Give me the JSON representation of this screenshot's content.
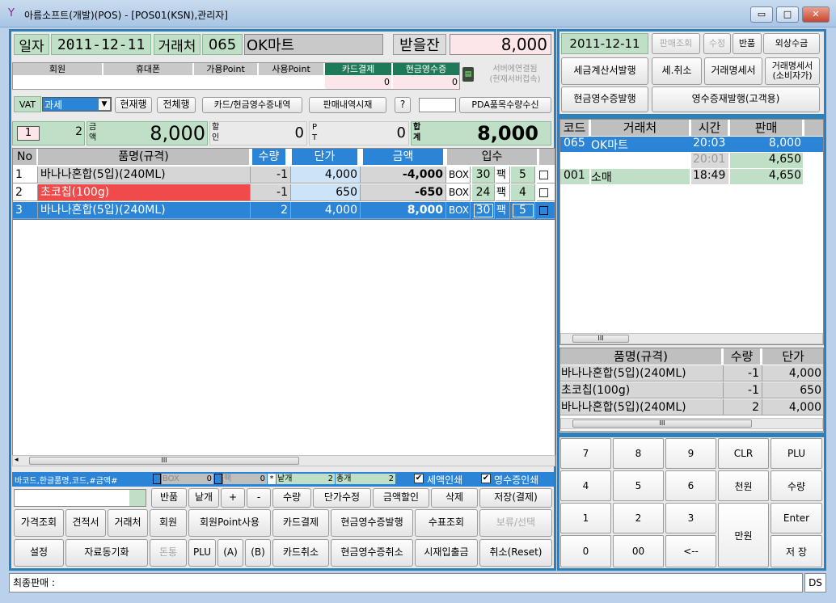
{
  "window": {
    "title": "아름소프트(개발)(POS) - [POS01(KSN),관리자]",
    "min": "▭",
    "max": "□",
    "close": "✕"
  },
  "header": {
    "date_label": "일자",
    "date": "2011-12-11",
    "client_label": "거래처",
    "client_code": "065",
    "client_name": "OK마트",
    "receive_label": "받을잔",
    "receive_amount": "8,000"
  },
  "member": {
    "cols": [
      "회원",
      "휴대폰",
      "가용Point",
      "사용Point",
      "카드결제",
      "현금영수증"
    ],
    "card_value": "0",
    "cash_receipt_value": "0",
    "server_status": "서버에연결됨\n(현재서버접속)"
  },
  "toolbar": {
    "vat_label": "VAT",
    "vat_value": "과세",
    "buttons": [
      "현재행",
      "전체행",
      "카드/현금영수증내역",
      "판매내역시재",
      "?"
    ],
    "pda_label": "PDA품목수량수신"
  },
  "totals": {
    "count_box": "1",
    "count": "2",
    "amount_label": "금\n액",
    "amount": "8,000",
    "discount_label": "할\n인",
    "discount": "0",
    "pt_label": "P\nT",
    "pt": "0",
    "total_label": "합\n계",
    "total": "8,000"
  },
  "table": {
    "headers": [
      "No",
      "품명(규격)",
      "수량",
      "단가",
      "금액",
      "입수",
      ""
    ],
    "rows": [
      {
        "no": "1",
        "name": "바나나혼합(5입)(240ML)",
        "qty": "-1",
        "price": "4,000",
        "amount": "-4,000",
        "unit": "BOX",
        "box": "30",
        "pack_label": "팩",
        "pack": "5"
      },
      {
        "no": "2",
        "name": "초코칩(100g)",
        "qty": "-1",
        "price": "650",
        "amount": "-650",
        "unit": "BOX",
        "box": "24",
        "pack_label": "팩",
        "pack": "4"
      },
      {
        "no": "3",
        "name": "바나나혼합(5입)(240ML)",
        "qty": "2",
        "price": "4,000",
        "amount": "8,000",
        "unit": "BOX",
        "box": "30",
        "pack_label": "팩",
        "pack": "5"
      }
    ]
  },
  "scan": {
    "hint": "바코드,한글품명,코드,#금액#",
    "box_label": "BOX",
    "box_val": "0",
    "pack_label": "팩",
    "pack_val": "0",
    "star": "*",
    "each_label": "낱개",
    "each_val": "2",
    "total_label": "총개",
    "total_val": "2",
    "tax_print": "세액인쇄",
    "receipt_print": "영수증인쇄"
  },
  "actions": {
    "row1": [
      "반품",
      "낱개",
      "+",
      "-",
      "수량",
      "단가수정",
      "금액할인",
      "삭제",
      "저장(결제)"
    ],
    "row2": [
      "가격조회",
      "견적서",
      "거래처",
      "회원",
      "회원Point사용",
      "카드결제",
      "현금영수증발행",
      "수표조회",
      "보류/선택"
    ],
    "row3": [
      "설정",
      "자료동기화",
      "돈통",
      "PLU",
      "(A)",
      "(B)",
      "카드취소",
      "현금영수증취소",
      "시재입출금",
      "취소(Reset)"
    ]
  },
  "right_top": {
    "date": "2011-12-11",
    "btns": [
      "판매조회",
      "수정",
      "반품",
      "외상수금",
      "세금계산서발행",
      "세.취소",
      "거래명세서",
      "거래명세서\n(소비자가)",
      "현금영수증발행",
      "영수증재발행(고객용)"
    ]
  },
  "history": {
    "headers": [
      "코드",
      "거래처",
      "시간",
      "판매"
    ],
    "rows": [
      [
        "065",
        "OK마트",
        "20:03",
        "8,000"
      ],
      [
        "",
        "",
        "20:01",
        "4,650"
      ],
      [
        "001",
        "소매",
        "18:49",
        "4,650"
      ]
    ]
  },
  "detail": {
    "headers": [
      "품명(규격)",
      "수량",
      "단가"
    ],
    "rows": [
      [
        "바나나혼합(5입)(240ML)",
        "-1",
        "4,000"
      ],
      [
        "초코칩(100g)",
        "-1",
        "650"
      ],
      [
        "바나나혼합(5입)(240ML)",
        "2",
        "4,000"
      ]
    ]
  },
  "keypad": {
    "keys": [
      "7",
      "8",
      "9",
      "CLR",
      "PLU",
      "4",
      "5",
      "6",
      "천원",
      "수량",
      "1",
      "2",
      "3",
      "Enter",
      "0",
      "00",
      "<--",
      "만원",
      "저 장"
    ]
  },
  "status": {
    "last_sale": "최종판매 :",
    "ds": "DS"
  },
  "colors": {
    "accent": "#2b84d6",
    "frame": "#2f7fb8",
    "label_green": "#bfe0c6",
    "receive_pink": "#fde6e9",
    "red_row": "#f04a4a",
    "table_header": "#bfbfbf"
  }
}
